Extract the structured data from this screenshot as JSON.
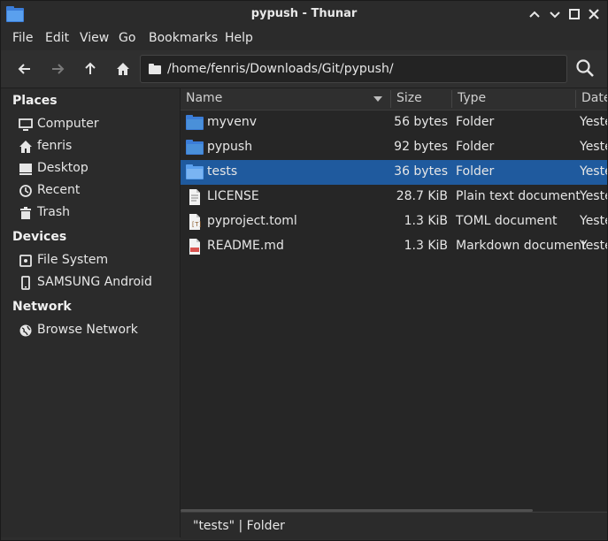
{
  "window": {
    "title": "pypush - Thunar"
  },
  "menubar": {
    "items": [
      "File",
      "Edit",
      "View",
      "Go",
      "Bookmarks",
      "Help"
    ]
  },
  "toolbar": {
    "back_icon": "arrow-left-icon",
    "forward_icon": "arrow-right-icon",
    "up_icon": "arrow-up-icon",
    "home_icon": "home-icon",
    "path": "/home/fenris/Downloads/Git/pypush/",
    "search_icon": "search-icon"
  },
  "sidebar": {
    "places_heading": "Places",
    "places": [
      {
        "label": "Computer",
        "icon": "monitor-icon"
      },
      {
        "label": "fenris",
        "icon": "home-icon"
      },
      {
        "label": "Desktop",
        "icon": "desktop-icon"
      },
      {
        "label": "Recent",
        "icon": "clock-icon"
      },
      {
        "label": "Trash",
        "icon": "trash-icon"
      }
    ],
    "devices_heading": "Devices",
    "devices": [
      {
        "label": "File System",
        "icon": "drive-icon"
      },
      {
        "label": "SAMSUNG Android",
        "icon": "phone-icon"
      }
    ],
    "network_heading": "Network",
    "network": [
      {
        "label": "Browse Network",
        "icon": "globe-icon"
      }
    ]
  },
  "columns": {
    "name": "Name",
    "size": "Size",
    "type": "Type",
    "date": "Date"
  },
  "files": [
    {
      "name": "myvenv",
      "size": "56 bytes",
      "type": "Folder",
      "date": "Yeste",
      "icon": "folder-icon"
    },
    {
      "name": "pypush",
      "size": "92 bytes",
      "type": "Folder",
      "date": "Yeste",
      "icon": "folder-icon"
    },
    {
      "name": "tests",
      "size": "36 bytes",
      "type": "Folder",
      "date": "Yeste",
      "icon": "folder-icon",
      "selected": true
    },
    {
      "name": "LICENSE",
      "size": "28.7 KiB",
      "type": "Plain text document",
      "date": "Yeste",
      "icon": "text-file-icon"
    },
    {
      "name": "pyproject.toml",
      "size": "1.3 KiB",
      "type": "TOML document",
      "date": "Yeste",
      "icon": "toml-file-icon"
    },
    {
      "name": "README.md",
      "size": "1.3 KiB",
      "type": "Markdown document",
      "date": "Yeste",
      "icon": "markdown-file-icon"
    }
  ],
  "status": {
    "text": "\"tests\"  |  Folder"
  },
  "colors": {
    "selection": "#1f5a9e",
    "folder": "#4a90d9"
  }
}
